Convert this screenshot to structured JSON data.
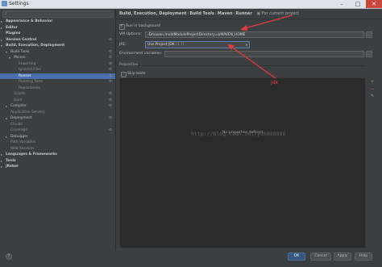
{
  "window": {
    "title": "Settings",
    "minimize": "–",
    "maximize": "□",
    "close": "✕"
  },
  "search": {
    "icon": "search-icon",
    "value": ""
  },
  "tree": [
    {
      "label": "Appearance & Behavior",
      "level": 0,
      "arrow": "▸",
      "bold": true
    },
    {
      "label": "Editor",
      "level": 0,
      "arrow": "▸",
      "bold": true
    },
    {
      "label": "Plugins",
      "level": 0,
      "arrow": "",
      "bold": true
    },
    {
      "label": "Version Control",
      "level": 0,
      "arrow": "▸",
      "bold": true,
      "gear": true
    },
    {
      "label": "Build, Execution, Deployment",
      "level": 0,
      "arrow": "▾",
      "bold": true
    },
    {
      "label": "Build Tools",
      "level": 1,
      "arrow": "▾",
      "gear": true
    },
    {
      "label": "Maven",
      "level": 2,
      "arrow": "▾",
      "gear": true
    },
    {
      "label": "Importing",
      "level": 3,
      "arrow": "",
      "gear": true,
      "dim": true
    },
    {
      "label": "Ignored Files",
      "level": 3,
      "arrow": "",
      "gear": true,
      "dim": true
    },
    {
      "label": "Runner",
      "level": 3,
      "arrow": "",
      "gear": true,
      "selected": true
    },
    {
      "label": "Running Tests",
      "level": 3,
      "arrow": "",
      "gear": true,
      "dim": true
    },
    {
      "label": "Repositories",
      "level": 3,
      "arrow": "",
      "dim": true
    },
    {
      "label": "Gradle",
      "level": 2,
      "arrow": "",
      "gear": true,
      "dim": true
    },
    {
      "label": "Gant",
      "level": 2,
      "arrow": "",
      "gear": true,
      "dim": true
    },
    {
      "label": "Compiler",
      "level": 1,
      "arrow": "▸",
      "gear": true
    },
    {
      "label": "Application Servers",
      "level": 1,
      "arrow": "",
      "dim": true
    },
    {
      "label": "Deployment",
      "level": 1,
      "arrow": "▸",
      "gear": true
    },
    {
      "label": "Clouds",
      "level": 1,
      "arrow": "",
      "dim": true
    },
    {
      "label": "Coverage",
      "level": 1,
      "arrow": "",
      "gear": true,
      "dim": true
    },
    {
      "label": "Debugger",
      "level": 1,
      "arrow": "▸"
    },
    {
      "label": "Path Variables",
      "level": 1,
      "arrow": "",
      "dim": true
    },
    {
      "label": "Web Services",
      "level": 1,
      "arrow": "",
      "dim": true
    },
    {
      "label": "Languages & Frameworks",
      "level": 0,
      "arrow": "▸",
      "bold": true
    },
    {
      "label": "Tools",
      "level": 0,
      "arrow": "▸",
      "bold": true
    },
    {
      "label": "JRebel",
      "level": 0,
      "arrow": "▸",
      "bold": true
    }
  ],
  "breadcrumb": {
    "items": [
      "Build, Execution, Deployment",
      "Build Tools",
      "Maven",
      "Runner"
    ],
    "separator": "›",
    "project_note": "For current project",
    "project_icon": "project-icon"
  },
  "runner": {
    "run_in_background": {
      "label": "Run in background",
      "checked": true
    },
    "vm_options": {
      "label": "VM Options:",
      "value": "-Dmaven.multiModuleProjectDirectory=$MAVEN_HOME",
      "button": "..."
    },
    "jre": {
      "label": "JRE:",
      "value": "Use Project JDK",
      "hint": "(1.7)"
    },
    "env_vars": {
      "label": "Environment variables:",
      "value": "",
      "button": "..."
    },
    "properties_title": "Properties",
    "skip_tests": {
      "label": "Skip tests",
      "checked": false
    },
    "properties_empty": "No properties defined",
    "watermark": "http://blog.csdn.net/ydk888888",
    "side_buttons": {
      "add": "+",
      "remove": "−",
      "edit": "✎"
    },
    "annotation": "jdk"
  },
  "footer": {
    "help": "?",
    "ok": "OK",
    "cancel": "Cancel",
    "apply": "Apply",
    "help_button": "Help"
  },
  "colors": {
    "accent": "#4b6eaf",
    "background": "#3c3f41",
    "annotation": "#e23c3c"
  }
}
